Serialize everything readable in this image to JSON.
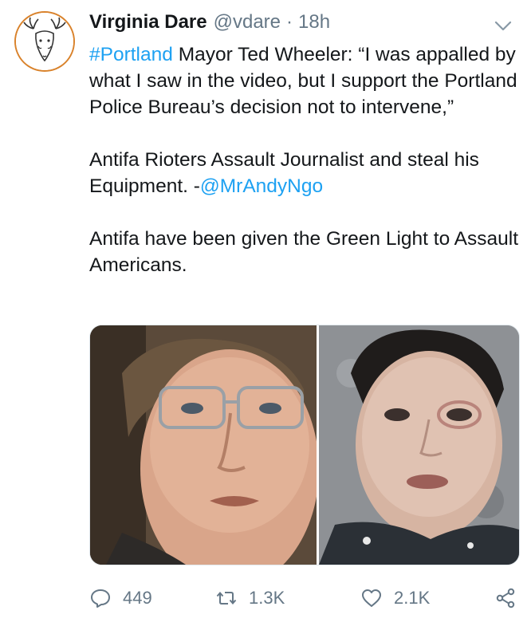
{
  "tweet": {
    "author": {
      "display_name": "Virginia Dare",
      "handle": "@vdare",
      "separator": "·",
      "time": "18h",
      "avatar_icon": "deer-head-logo"
    },
    "menu_icon": "chevron-down-icon",
    "body": {
      "p1_hashtag": "#Portland",
      "p1_text": " Mayor Ted Wheeler: “I was appalled by what I saw in the video, but I support the Portland Police Bureau’s decision not to intervene,”",
      "p2_text": "Antifa Rioters Assault Journalist and steal his Equipment. -",
      "p2_mention": "@MrAndyNgo",
      "p3_text": "Antifa have been given the Green Light to Assault Americans."
    },
    "media": {
      "images": [
        "photo-left",
        "photo-right"
      ]
    },
    "actions": {
      "replies": "449",
      "retweets": "1.3K",
      "likes": "2.1K",
      "reply_icon": "reply-icon",
      "retweet_icon": "retweet-icon",
      "like_icon": "heart-icon",
      "share_icon": "share-icon"
    },
    "colors": {
      "link": "#1da1f2",
      "muted": "#657786",
      "text": "#14171a",
      "avatar_ring": "#d9822b"
    }
  }
}
